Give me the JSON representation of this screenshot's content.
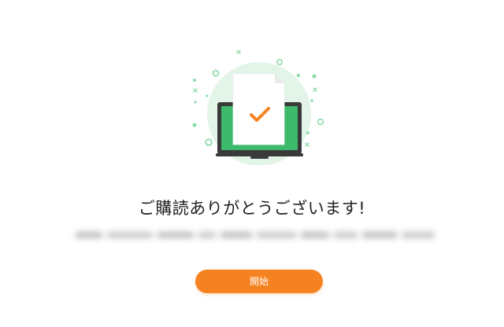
{
  "colors": {
    "accent": "#f58220",
    "success_green": "#3dba6b",
    "light_green": "#d7f2de",
    "dot_green": "#7ed6a0",
    "laptop_dark": "#3a3a3a"
  },
  "illustration": {
    "icon": "laptop-with-document-check-icon",
    "check_icon": "check-icon"
  },
  "message": {
    "title": "ご購読ありがとうございます!",
    "subtitle_blurred": ""
  },
  "actions": {
    "start_label": "開始"
  }
}
